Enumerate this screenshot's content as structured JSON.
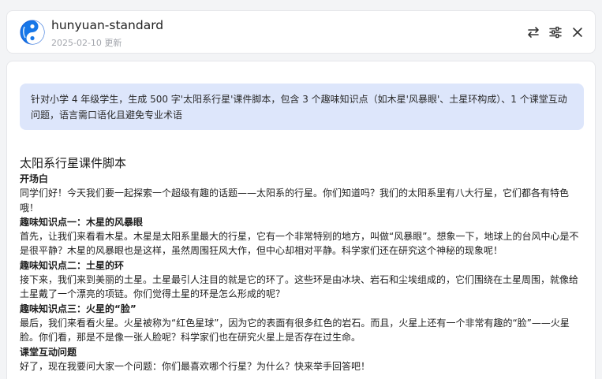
{
  "header": {
    "model_name": "hunyuan-standard",
    "updated": "2025-02-10 更新",
    "icons": [
      "swap-icon",
      "settings-sliders-icon",
      "close-icon"
    ]
  },
  "prompt": {
    "text": "针对小学 4 年级学生，生成 500 字'太阳系行星'课件脚本，包含 3 个趣味知识点（如木星'风暴眼'、土星环构成）、1 个课堂互动问题，语言需口语化且避免专业术语"
  },
  "answer": {
    "title": "太阳系行星课件脚本",
    "opening_heading": "开场白",
    "opening_text": "同学们好！今天我们要一起探索一个超级有趣的话题——太阳系的行星。你们知道吗？我们的太阳系里有八大行星，它们都各有特色哦！",
    "fact1_heading": "趣味知识点一：木星的风暴眼",
    "fact1_text": "首先，让我们来看看木星。木星是太阳系里最大的行星，它有一个非常特别的地方，叫做“风暴眼”。想象一下，地球上的台风中心是不是很平静？木星的风暴眼也是这样，虽然周围狂风大作，但中心却相对平静。科学家们还在研究这个神秘的现象呢！",
    "fact2_heading": "趣味知识点二：土星的环",
    "fact2_text": "接下来，我们来到美丽的土星。土星最引人注目的就是它的环了。这些环是由冰块、岩石和尘埃组成的，它们围绕在土星周围，就像给土星戴了一个漂亮的项链。你们觉得土星的环是怎么形成的呢？",
    "fact3_heading": "趣味知识点三：火星的“脸”",
    "fact3_text": "最后，我们来看看火星。火星被称为“红色星球”，因为它的表面有很多红色的岩石。而且，火星上还有一个非常有趣的“脸”——火星脸。你们看，那是不是像一张人脸呢？科学家们也在研究火星上是否存在过生命。",
    "interaction_heading": "课堂互动问题",
    "interaction_text": "好了，现在我要问大家一个问题：你们最喜欢哪个行星？为什么？快来举手回答吧！"
  }
}
